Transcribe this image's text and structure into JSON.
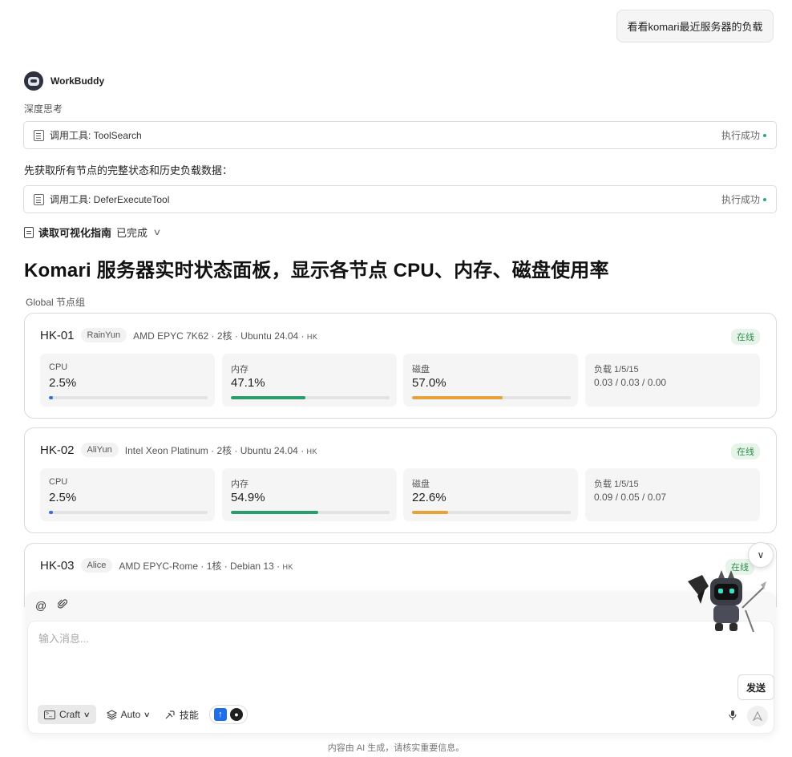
{
  "user_message": "看看komari最近服务器的负载",
  "bot": {
    "name": "WorkBuddy"
  },
  "thinking_label": "深度思考",
  "tool_calls": [
    {
      "label": "调用工具: ToolSearch",
      "status": "执行成功"
    },
    {
      "label": "调用工具: DeferExecuteTool",
      "status": "执行成功"
    }
  ],
  "step_text": "先获取所有节点的完整状态和历史负载数据：",
  "guide": {
    "title": "读取可视化指南",
    "status": "已完成"
  },
  "dashboard": {
    "title": "Komari 服务器实时状态面板，显示各节点 CPU、内存、磁盘使用率",
    "group_label": "Global 节点组",
    "nodes": [
      {
        "name": "HK-01",
        "provider": "RainYun",
        "spec": "AMD EPYC 7K62 · 2核 · Ubuntu 24.04 ·",
        "cc": "HK",
        "status": "在线",
        "cpu_label": "CPU",
        "cpu": "2.5%",
        "cpu_pct": 2.5,
        "mem_label": "内存",
        "mem": "47.1%",
        "mem_pct": 47.1,
        "disk_label": "磁盘",
        "disk": "57.0%",
        "disk_pct": 57.0,
        "load_label": "负载 1/5/15",
        "load": "0.03 / 0.03 / 0.00"
      },
      {
        "name": "HK-02",
        "provider": "AliYun",
        "spec": "Intel Xeon Platinum · 2核 · Ubuntu 24.04 ·",
        "cc": "HK",
        "status": "在线",
        "cpu_label": "CPU",
        "cpu": "2.5%",
        "cpu_pct": 2.5,
        "mem_label": "内存",
        "mem": "54.9%",
        "mem_pct": 54.9,
        "disk_label": "磁盘",
        "disk": "22.6%",
        "disk_pct": 22.6,
        "load_label": "负载 1/5/15",
        "load": "0.09 / 0.05 / 0.07"
      },
      {
        "name": "HK-03",
        "provider": "Alice",
        "spec": "AMD EPYC-Rome · 1核 · Debian 13 ·",
        "cc": "HK",
        "status": "在线"
      }
    ],
    "colors": {
      "cpu": "#2f6fe0",
      "mem": "#2a9d6f",
      "disk": "#e8a23a"
    }
  },
  "composer": {
    "placeholder": "输入消息...",
    "send_label": "发送",
    "mode_label": "Craft",
    "model_label": "Auto",
    "skills_label": "技能",
    "icons": [
      "at-icon",
      "paperclip-icon",
      "terminal-icon",
      "layers-icon",
      "tool-icon",
      "brand-icon",
      "github-icon",
      "mic-icon",
      "send-arrow-icon"
    ]
  },
  "footer_note": "内容由 AI 生成，请核实重要信息。"
}
